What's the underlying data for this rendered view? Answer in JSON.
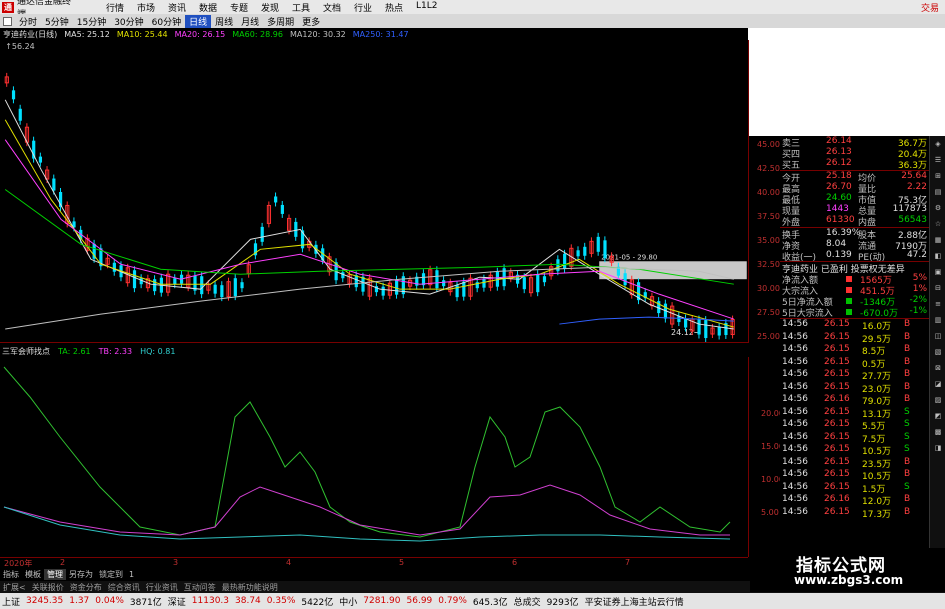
{
  "titlebar": {
    "logo": "通",
    "title": "通达信金融终端",
    "menu": [
      "行情",
      "市场",
      "资讯",
      "数据",
      "专题",
      "发现",
      "工具",
      "文档",
      "行业",
      "热点",
      "L1L2"
    ],
    "trade": "交易"
  },
  "periods": [
    {
      "label": "分时",
      "active": false
    },
    {
      "label": "5分钟",
      "active": false
    },
    {
      "label": "15分钟",
      "active": false
    },
    {
      "label": "30分钟",
      "active": false
    },
    {
      "label": "60分钟",
      "active": false
    },
    {
      "label": "日线",
      "active": true
    },
    {
      "label": "周线",
      "active": false
    },
    {
      "label": "月线",
      "active": false
    },
    {
      "label": "多周期",
      "active": false
    },
    {
      "label": "更多",
      "active": false
    }
  ],
  "maline": {
    "stock": "亨迪药业(日线)",
    "items": [
      {
        "text": "MA5: 25.12",
        "color": "#e0e0e0"
      },
      {
        "text": "MA10: 25.44",
        "color": "#e0e000"
      },
      {
        "text": "MA20: 26.15",
        "color": "#ff40ff"
      },
      {
        "text": "MA60: 28.96",
        "color": "#00d000"
      },
      {
        "text": "MA120: 30.32",
        "color": "#c0c0c0"
      },
      {
        "text": "MA250: 31.47",
        "color": "#3060ff"
      }
    ],
    "high_label": "56.24"
  },
  "price_axis": [
    "45.00",
    "42.50",
    "40.00",
    "37.50",
    "35.00",
    "32.50",
    "30.00",
    "27.50",
    "25.00"
  ],
  "chart_annotations": {
    "range_label": "24.12",
    "box_label": "2021-05 - 29.80"
  },
  "indicator": {
    "name": "三军会师找点",
    "items": [
      {
        "text": "TA: 2.61",
        "color": "#00d000"
      },
      {
        "text": "TB: 2.33",
        "color": "#ff40ff"
      },
      {
        "text": "HQ: 0.81",
        "color": "#30d0d0"
      }
    ],
    "axis": [
      "20.00",
      "15.00",
      "10.00",
      "5.00"
    ]
  },
  "dates": [
    "2020年",
    "2",
    "3",
    "4",
    "5",
    "6",
    "7"
  ],
  "bottom_tabs": [
    {
      "label": "指标",
      "sel": false
    },
    {
      "label": "模板",
      "sel": false
    },
    {
      "label": "管理",
      "sel": true
    },
    {
      "label": "另存为",
      "sel": false
    },
    {
      "label": "锁定到",
      "sel": false
    },
    {
      "label": "1",
      "sel": false
    }
  ],
  "sub_tabs": [
    "扩展<",
    "关联报价",
    "资金分布",
    "综合资讯",
    "行业资讯",
    "互动问答",
    "最热新功能说明"
  ],
  "quote_panel": {
    "asks": [
      {
        "label": "卖三",
        "price": "26.14",
        "vol": "36.7万"
      },
      {
        "label": "买四",
        "price": "26.13",
        "vol": "20.4万"
      },
      {
        "label": "买五",
        "price": "26.12",
        "vol": "36.3万"
      }
    ],
    "stats": [
      {
        "l1": "今开",
        "v1": "25.18",
        "c1": "redtxt",
        "l2": "均价",
        "v2": "25.64",
        "c2": "redtxt"
      },
      {
        "l1": "最高",
        "v1": "26.70",
        "c1": "redtxt",
        "l2": "量比",
        "v2": "2.22",
        "c2": "redtxt"
      },
      {
        "l1": "最低",
        "v1": "24.60",
        "c1": "grntxt",
        "l2": "市值",
        "v2": "75.3亿",
        "c2": "wht"
      },
      {
        "l1": "现量",
        "v1": "1443",
        "c1": "mag",
        "l2": "总量",
        "v2": "117873",
        "c2": "wht"
      },
      {
        "l1": "外盘",
        "v1": "61330",
        "c1": "redtxt",
        "l2": "内盘",
        "v2": "56543",
        "c2": "grntxt"
      }
    ],
    "stats2": [
      {
        "l1": "换手",
        "v1": "16.39%",
        "c1": "wht",
        "l2": "股本",
        "v2": "2.88亿",
        "c2": "wht"
      },
      {
        "l1": "净资",
        "v1": "8.04",
        "c1": "wht",
        "l2": "流通",
        "v2": "7190万",
        "c2": "wht"
      },
      {
        "l1": "收益(一)",
        "v1": "0.139",
        "c1": "wht",
        "l2": "PE(动)",
        "v2": "47.2",
        "c2": "wht"
      }
    ],
    "flow_header": "亨迪药业 已盈利 投票权无差异",
    "flows": [
      {
        "label": "净流入额",
        "bar": "red",
        "val": "1565万",
        "pct": "5%",
        "vc": "redtxt"
      },
      {
        "label": "大宗流入",
        "bar": "red",
        "val": "451.5万",
        "pct": "1%",
        "vc": "redtxt"
      },
      {
        "label": "5日净流入额",
        "bar": "grn",
        "val": "-1346万",
        "pct": "-2%",
        "vc": "grntxt"
      },
      {
        "label": "5日大宗流入",
        "bar": "grn",
        "val": "-670.0万",
        "pct": "-1%",
        "vc": "grntxt"
      }
    ],
    "ticks": [
      {
        "t": "14:56",
        "p": "26.15",
        "v": "16.0万",
        "d": "B"
      },
      {
        "t": "14:56",
        "p": "26.15",
        "v": "29.5万",
        "d": "B"
      },
      {
        "t": "14:56",
        "p": "26.15",
        "v": "8.5万",
        "d": "B"
      },
      {
        "t": "14:56",
        "p": "26.15",
        "v": "0.5万",
        "d": "B"
      },
      {
        "t": "14:56",
        "p": "26.15",
        "v": "27.7万",
        "d": "B"
      },
      {
        "t": "14:56",
        "p": "26.15",
        "v": "23.0万",
        "d": "B"
      },
      {
        "t": "14:56",
        "p": "26.16",
        "v": "79.0万",
        "d": "B"
      },
      {
        "t": "14:56",
        "p": "26.15",
        "v": "13.1万",
        "d": "S"
      },
      {
        "t": "14:56",
        "p": "26.15",
        "v": "5.5万",
        "d": "S"
      },
      {
        "t": "14:56",
        "p": "26.15",
        "v": "7.5万",
        "d": "S"
      },
      {
        "t": "14:56",
        "p": "26.15",
        "v": "10.5万",
        "d": "S"
      },
      {
        "t": "14:56",
        "p": "26.15",
        "v": "23.5万",
        "d": "B"
      },
      {
        "t": "14:56",
        "p": "26.15",
        "v": "10.5万",
        "d": "B"
      },
      {
        "t": "14:56",
        "p": "26.15",
        "v": "1.5万",
        "d": "S"
      },
      {
        "t": "14:56",
        "p": "26.16",
        "v": "12.0万",
        "d": "B"
      },
      {
        "t": "14:56",
        "p": "26.15",
        "v": "17.3万",
        "d": "B"
      }
    ]
  },
  "right_tools": [
    "◈",
    "☰",
    "⊞",
    "▤",
    "⚙",
    "☆",
    "▦",
    "◧",
    "▣",
    "⊟",
    "≡",
    "▥",
    "◫",
    "▧",
    "⊠",
    "◪",
    "▨",
    "◩",
    "▩",
    "◨"
  ],
  "watermark": {
    "line1": "指标公式网",
    "line2": "www.zbgs3.com"
  },
  "statusbar": [
    {
      "text": "上证",
      "c": ""
    },
    {
      "text": "3245.35",
      "c": "red"
    },
    {
      "text": "1.37",
      "c": "red"
    },
    {
      "text": "0.04%",
      "c": "red"
    },
    {
      "text": "3871亿",
      "c": ""
    },
    {
      "text": "深证",
      "c": ""
    },
    {
      "text": "11130.3",
      "c": "red"
    },
    {
      "text": "38.74",
      "c": "red"
    },
    {
      "text": "0.35%",
      "c": "red"
    },
    {
      "text": "5422亿",
      "c": ""
    },
    {
      "text": "中小",
      "c": ""
    },
    {
      "text": "7281.90",
      "c": "red"
    },
    {
      "text": "56.99",
      "c": "red"
    },
    {
      "text": "0.79%",
      "c": "red"
    },
    {
      "text": "645.3亿",
      "c": ""
    },
    {
      "text": "总成交",
      "c": ""
    },
    {
      "text": "9293亿",
      "c": ""
    },
    {
      "text": "平安证券上海主站云行情",
      "c": ""
    }
  ]
}
